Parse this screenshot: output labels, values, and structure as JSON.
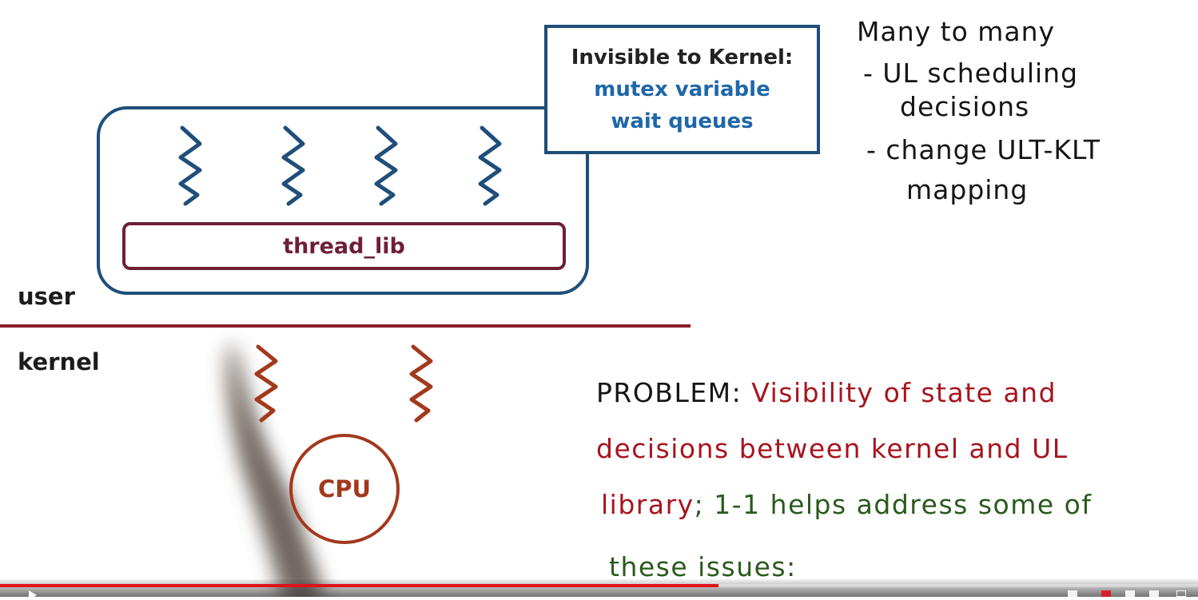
{
  "slide": {
    "invisible_box": {
      "title": "Invisible to Kernel:",
      "items": [
        "mutex variable",
        "wait queues"
      ]
    },
    "thread_lib_label": "thread_lib",
    "user_label": "user",
    "kernel_label": "kernel",
    "cpu_label": "CPU"
  },
  "notes": {
    "title": "Many to many",
    "bullets": [
      [
        "- UL scheduling",
        "decisions"
      ],
      [
        "- change ULT-KLT",
        "mapping"
      ]
    ]
  },
  "problem": {
    "lead": "PROBLEM:",
    "line1": "Visibility of state and",
    "line2": "decisions between kernel and UL",
    "line3_red": "library",
    "line3_green": "; 1-1 helps address some of",
    "line4": "these issues:"
  },
  "player": {
    "progress_fraction": 0.6,
    "time_text": ""
  },
  "colors": {
    "blue_box": "#1f4e7a",
    "blue_text": "#1f67a8",
    "maroon": "#6e1f35",
    "kernel_thread": "#a2391d",
    "divider": "#8a1f2a",
    "handwriting_red": "#a8141e",
    "handwriting_green": "#2a5a1d",
    "progress_red": "#e0121b"
  }
}
